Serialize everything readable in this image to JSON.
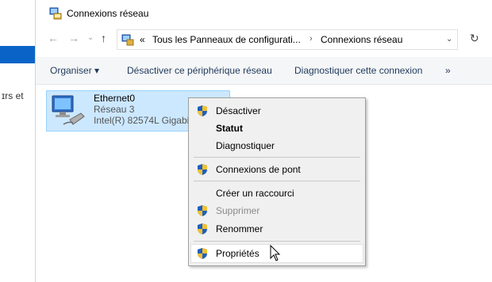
{
  "window": {
    "title": "Connexions réseau"
  },
  "background": {
    "sidebar_text": "ɪrs et"
  },
  "address_bar": {
    "prefix": "«",
    "crumbs": [
      "Tous les Panneaux de configurati...",
      "Connexions réseau"
    ],
    "separator": "›"
  },
  "toolbar": {
    "organize": "Organiser ▾",
    "disable": "Désactiver ce périphérique réseau",
    "diagnose": "Diagnostiquer cette connexion",
    "more": "»"
  },
  "connection": {
    "name": "Ethernet0",
    "network": "Réseau 3",
    "adapter": "Intel(R) 82574L Gigabit"
  },
  "context_menu": {
    "items": [
      {
        "label": "Désactiver",
        "icon": "shield-icon",
        "enabled": true,
        "bold": false
      },
      {
        "label": "Statut",
        "icon": "",
        "enabled": true,
        "bold": true
      },
      {
        "label": "Diagnostiquer",
        "icon": "",
        "enabled": true,
        "bold": false
      },
      {
        "label": "Connexions de pont",
        "icon": "shield-icon",
        "enabled": true,
        "bold": false
      },
      {
        "label": "Créer un raccourci",
        "icon": "",
        "enabled": true,
        "bold": false
      },
      {
        "label": "Supprimer",
        "icon": "shield-icon",
        "enabled": false,
        "bold": false
      },
      {
        "label": "Renommer",
        "icon": "shield-icon",
        "enabled": true,
        "bold": false
      },
      {
        "label": "Propriétés",
        "icon": "shield-icon",
        "enabled": true,
        "bold": false
      }
    ]
  },
  "colors": {
    "selection": "#cce8ff",
    "selection_border": "#99d1ff",
    "menu_bg": "#f0f0f0",
    "accent_blue": "#0a64c8"
  }
}
